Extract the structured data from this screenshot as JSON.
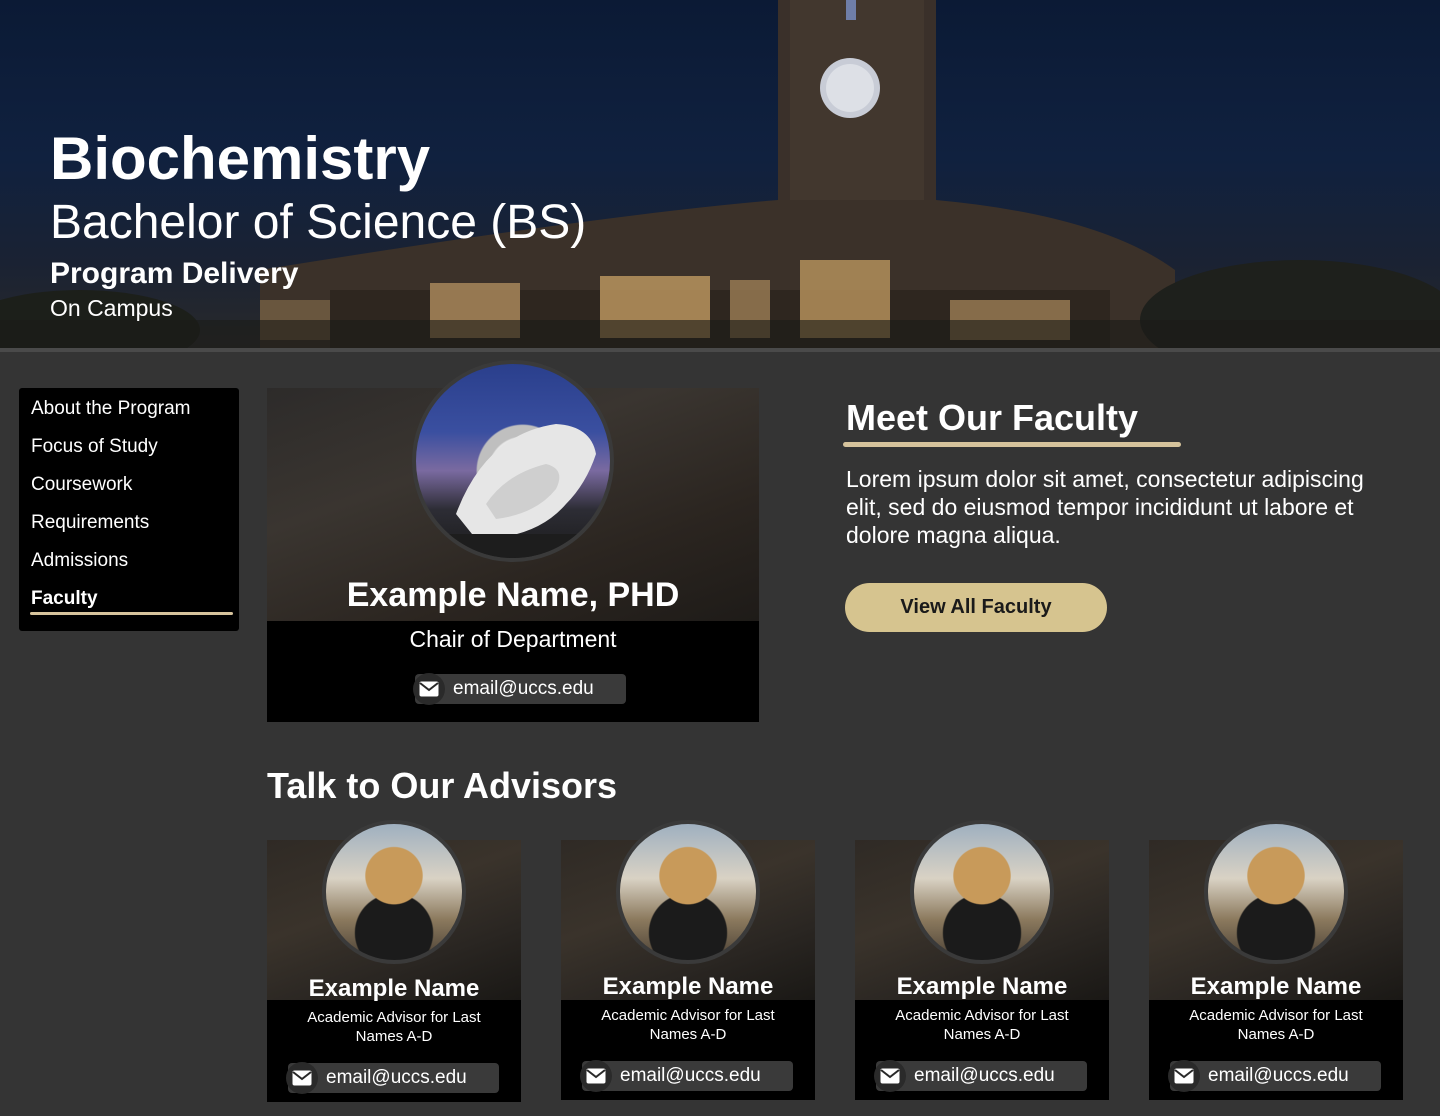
{
  "hero": {
    "title": "Biochemistry",
    "subtitle": "Bachelor of Science (BS)",
    "delivery_label": "Program Delivery",
    "delivery_value": "On Campus"
  },
  "sidebar": {
    "items": [
      {
        "label": "About the Program"
      },
      {
        "label": "Focus of Study"
      },
      {
        "label": "Coursework"
      },
      {
        "label": "Requirements"
      },
      {
        "label": "Admissions"
      },
      {
        "label": "Faculty"
      }
    ],
    "active": "Faculty"
  },
  "featured": {
    "name": "Example Name, PHD",
    "role": "Chair of Department",
    "email": "email@uccs.edu"
  },
  "meet": {
    "title": "Meet Our Faculty",
    "text": "Lorem ipsum dolor sit amet, consectetur adipiscing elit, sed do eiusmod  tempor incididunt ut labore et dolore magna aliqua.",
    "button": "View All Faculty"
  },
  "advisors": {
    "heading": "Talk to Our Advisors",
    "items": [
      {
        "name": "Example Name",
        "role": "Academic Advisor for Last Names A-D",
        "email": "email@uccs.edu"
      },
      {
        "name": "Example Name",
        "role": "Academic Advisor for Last Names A-D",
        "email": "email@uccs.edu"
      },
      {
        "name": "Example Name",
        "role": "Academic Advisor for Last Names A-D",
        "email": "email@uccs.edu"
      },
      {
        "name": "Example Name",
        "role": "Academic Advisor for Last Names A-D",
        "email": "email@uccs.edu"
      }
    ]
  },
  "colors": {
    "background": "#343434",
    "accent_gold": "#d6c39c",
    "button_gold": "#d6c48f",
    "card_black": "#000000"
  },
  "icons": [
    "envelope-icon"
  ]
}
